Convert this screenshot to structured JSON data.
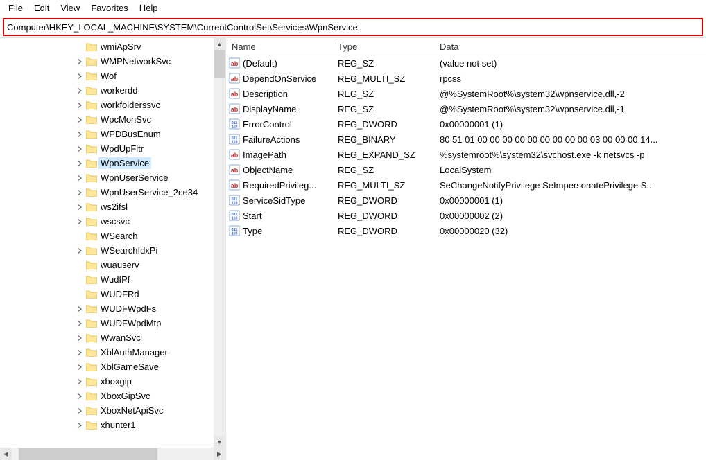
{
  "menu": {
    "file": "File",
    "edit": "Edit",
    "view": "View",
    "favorites": "Favorites",
    "help": "Help"
  },
  "address": "Computer\\HKEY_LOCAL_MACHINE\\SYSTEM\\CurrentControlSet\\Services\\WpnService",
  "tree": [
    {
      "label": "wmiApSrv",
      "exp": false
    },
    {
      "label": "WMPNetworkSvc",
      "exp": true
    },
    {
      "label": "Wof",
      "exp": true
    },
    {
      "label": "workerdd",
      "exp": true
    },
    {
      "label": "workfolderssvc",
      "exp": true
    },
    {
      "label": "WpcMonSvc",
      "exp": true
    },
    {
      "label": "WPDBusEnum",
      "exp": true
    },
    {
      "label": "WpdUpFltr",
      "exp": true
    },
    {
      "label": "WpnService",
      "exp": true,
      "sel": true
    },
    {
      "label": "WpnUserService",
      "exp": true
    },
    {
      "label": "WpnUserService_2ce34",
      "exp": true
    },
    {
      "label": "ws2ifsl",
      "exp": true
    },
    {
      "label": "wscsvc",
      "exp": true
    },
    {
      "label": "WSearch",
      "exp": false
    },
    {
      "label": "WSearchIdxPi",
      "exp": true
    },
    {
      "label": "wuauserv",
      "exp": false
    },
    {
      "label": "WudfPf",
      "exp": false
    },
    {
      "label": "WUDFRd",
      "exp": false
    },
    {
      "label": "WUDFWpdFs",
      "exp": true
    },
    {
      "label": "WUDFWpdMtp",
      "exp": true
    },
    {
      "label": "WwanSvc",
      "exp": true
    },
    {
      "label": "XblAuthManager",
      "exp": true
    },
    {
      "label": "XblGameSave",
      "exp": true
    },
    {
      "label": "xboxgip",
      "exp": true
    },
    {
      "label": "XboxGipSvc",
      "exp": true
    },
    {
      "label": "XboxNetApiSvc",
      "exp": true
    },
    {
      "label": "xhunter1",
      "exp": true
    }
  ],
  "columns": {
    "name": "Name",
    "type": "Type",
    "data": "Data"
  },
  "values": [
    {
      "icon": "str",
      "name": "(Default)",
      "type": "REG_SZ",
      "data": "(value not set)"
    },
    {
      "icon": "str",
      "name": "DependOnService",
      "type": "REG_MULTI_SZ",
      "data": "rpcss"
    },
    {
      "icon": "str",
      "name": "Description",
      "type": "REG_SZ",
      "data": "@%SystemRoot%\\system32\\wpnservice.dll,-2"
    },
    {
      "icon": "str",
      "name": "DisplayName",
      "type": "REG_SZ",
      "data": "@%SystemRoot%\\system32\\wpnservice.dll,-1"
    },
    {
      "icon": "bin",
      "name": "ErrorControl",
      "type": "REG_DWORD",
      "data": "0x00000001 (1)"
    },
    {
      "icon": "bin",
      "name": "FailureActions",
      "type": "REG_BINARY",
      "data": "80 51 01 00 00 00 00 00 00 00 00 00 03 00 00 00 14..."
    },
    {
      "icon": "str",
      "name": "ImagePath",
      "type": "REG_EXPAND_SZ",
      "data": "%systemroot%\\system32\\svchost.exe -k netsvcs -p"
    },
    {
      "icon": "str",
      "name": "ObjectName",
      "type": "REG_SZ",
      "data": "LocalSystem"
    },
    {
      "icon": "str",
      "name": "RequiredPrivileg...",
      "type": "REG_MULTI_SZ",
      "data": "SeChangeNotifyPrivilege SeImpersonatePrivilege S..."
    },
    {
      "icon": "bin",
      "name": "ServiceSidType",
      "type": "REG_DWORD",
      "data": "0x00000001 (1)"
    },
    {
      "icon": "bin",
      "name": "Start",
      "type": "REG_DWORD",
      "data": "0x00000002 (2)"
    },
    {
      "icon": "bin",
      "name": "Type",
      "type": "REG_DWORD",
      "data": "0x00000020 (32)"
    }
  ]
}
